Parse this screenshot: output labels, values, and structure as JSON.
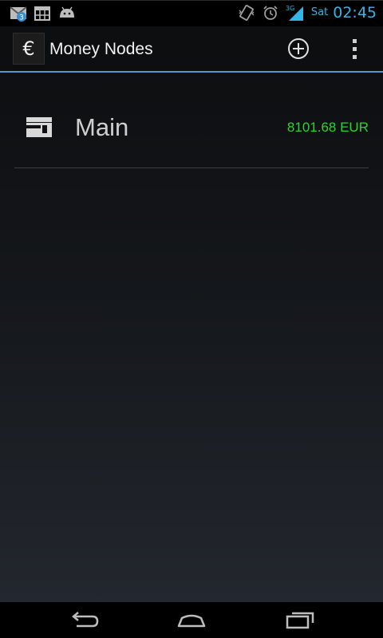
{
  "status_bar": {
    "day": "Sat",
    "time": "02:45",
    "network": "3G",
    "notification_count": "3",
    "icons": [
      "gmail-icon",
      "calendar-icon",
      "android-icon",
      "vibrate-icon",
      "alarm-icon",
      "signal-icon"
    ]
  },
  "action_bar": {
    "app_icon_glyph": "€",
    "title": "Money Nodes",
    "add_icon": "add-circle-icon",
    "overflow_icon": "overflow-menu-icon"
  },
  "accounts": [
    {
      "name": "Main",
      "balance": "8101.68 EUR",
      "icon": "wallet-icon"
    }
  ],
  "nav_bar": {
    "icons": [
      "back-icon",
      "home-icon",
      "recents-icon"
    ]
  },
  "colors": {
    "accent": "#33b5e5",
    "divider_blue": "#4a9ccf",
    "balance_green": "#2bd62b"
  }
}
